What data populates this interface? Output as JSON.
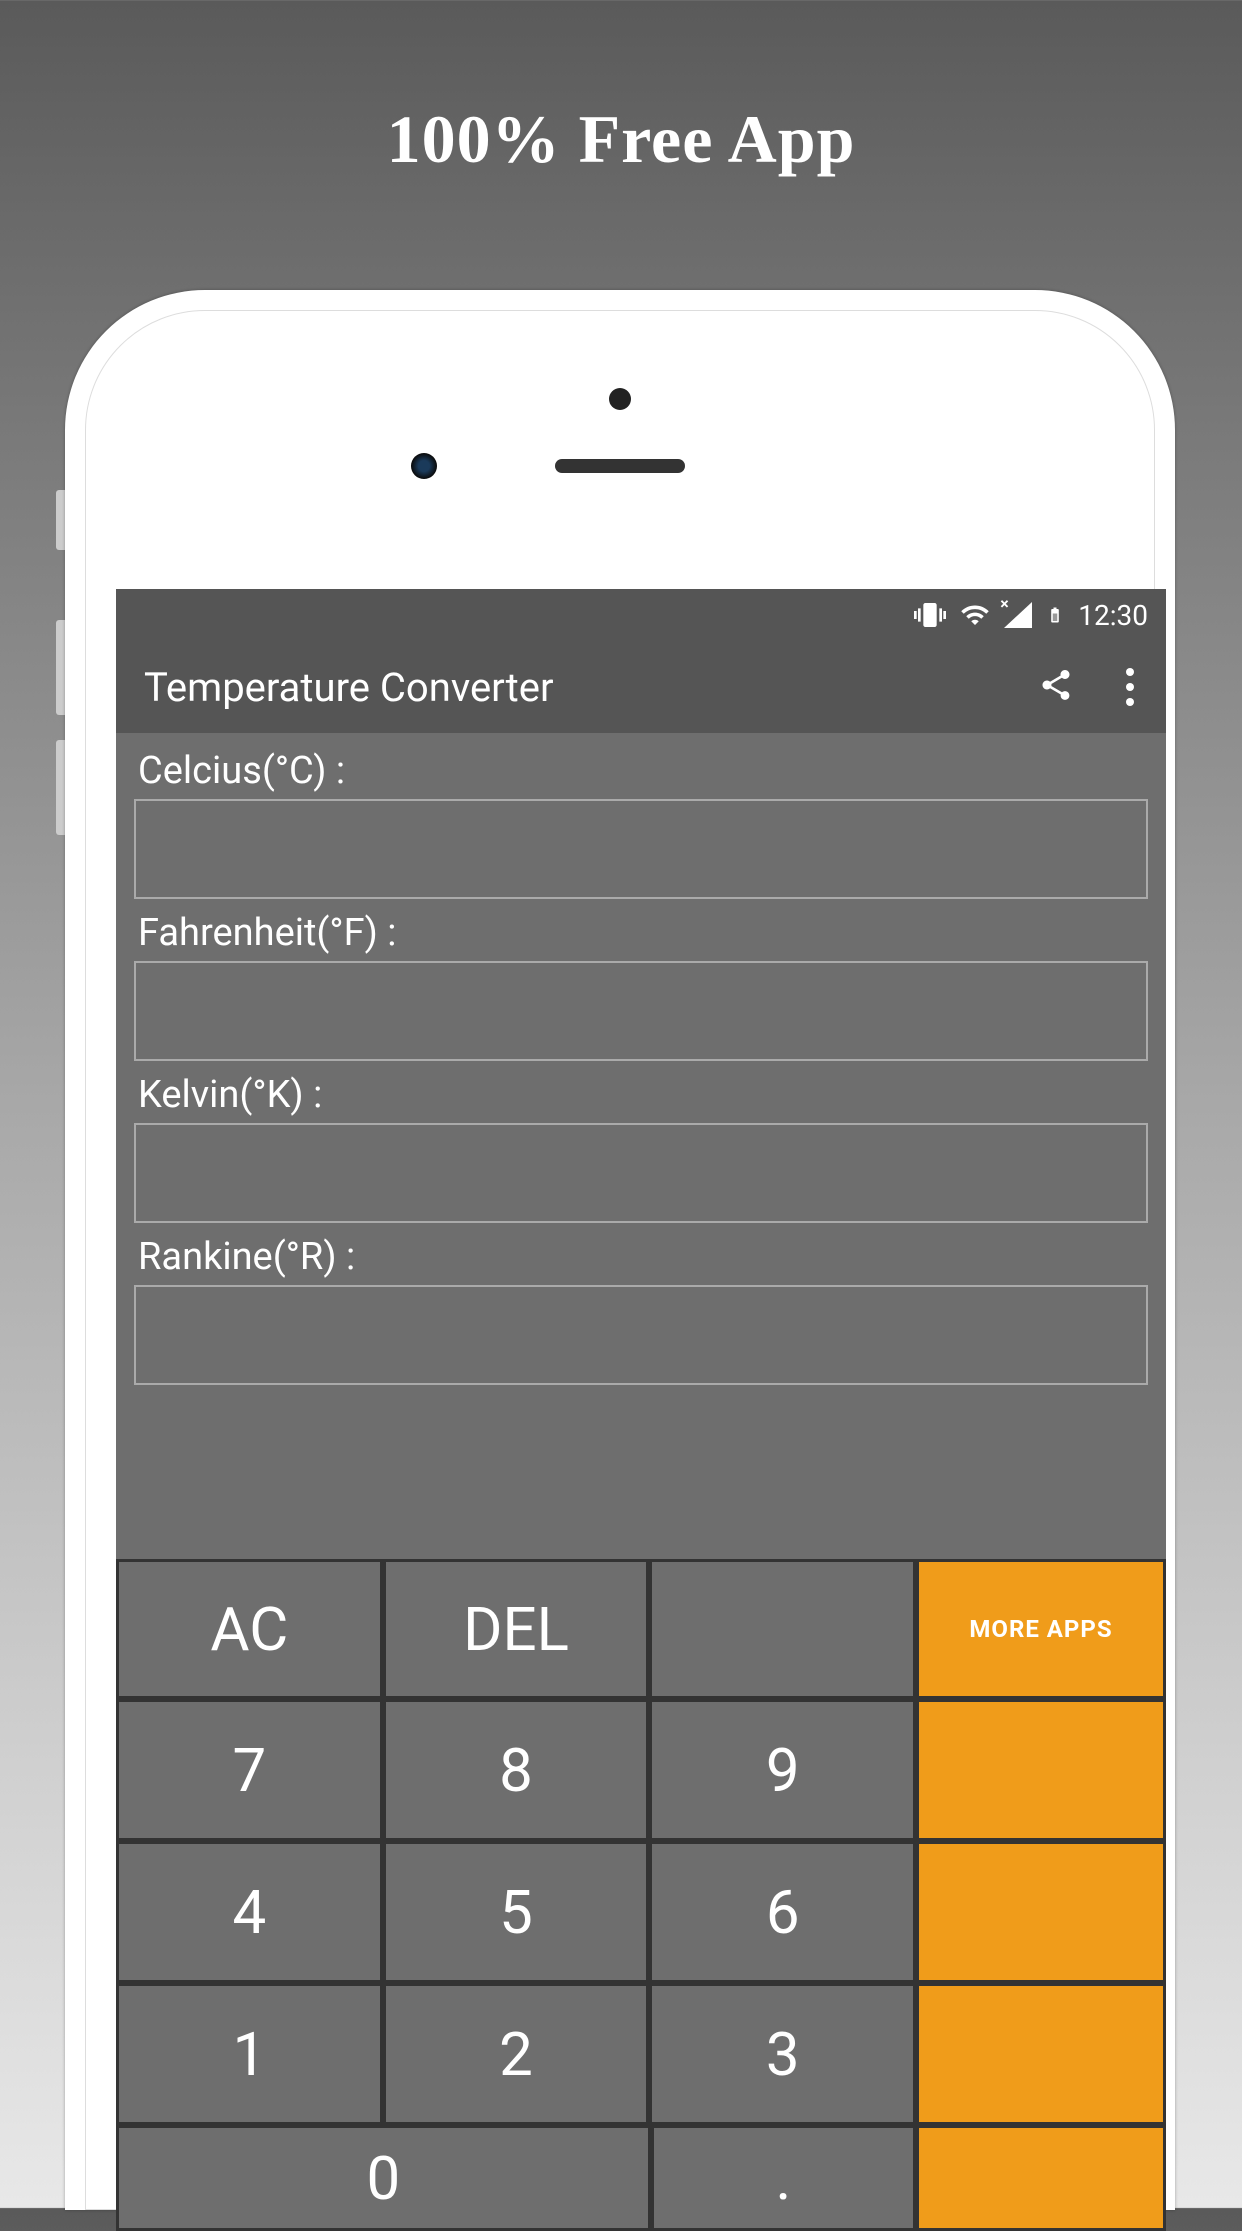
{
  "headline": "100% Free App",
  "status_bar": {
    "time": "12:30"
  },
  "header": {
    "title": "Temperature Converter"
  },
  "fields": {
    "celsius_label": "Celcius(°C) :",
    "fahrenheit_label": "Fahrenheit(°F) :",
    "kelvin_label": "Kelvin(°K) :",
    "rankine_label": "Rankine(°R) :",
    "celsius_value": "",
    "fahrenheit_value": "",
    "kelvin_value": "",
    "rankine_value": ""
  },
  "keypad": {
    "ac": "AC",
    "del": "DEL",
    "more_apps": "MORE APPS",
    "k7": "7",
    "k8": "8",
    "k9": "9",
    "k4": "4",
    "k5": "5",
    "k6": "6",
    "k1": "1",
    "k2": "2",
    "k3": "3",
    "k0": "0",
    "dot": "."
  }
}
